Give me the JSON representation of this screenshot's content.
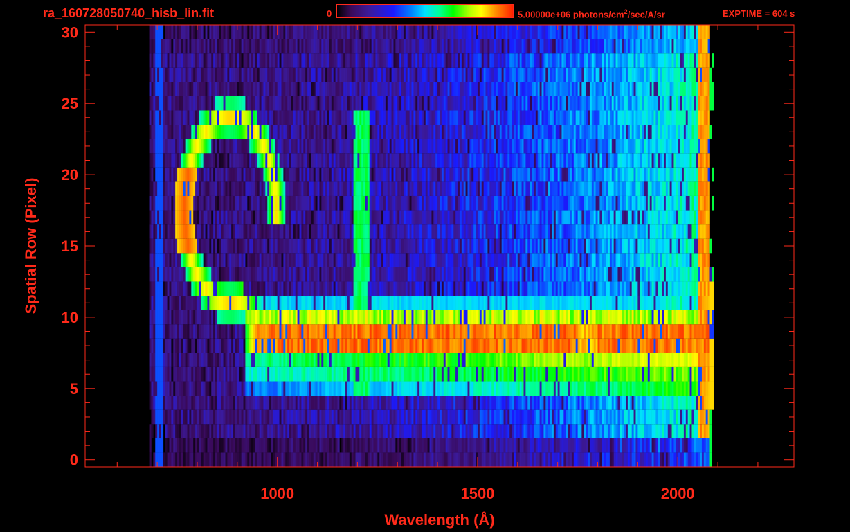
{
  "header": {
    "file_title": "ra_160728050740_hisb_lin.fit",
    "colorbar_min": "0",
    "colorbar_max_prefix": "5.00000e+06 photons/cm",
    "colorbar_max_sup": "2",
    "colorbar_max_suffix": "/sec/A/sr",
    "exptime": "EXPTIME = 604 s"
  },
  "colors": {
    "axis": "#ff2a1a",
    "background": "#000000"
  },
  "chart_data": {
    "type": "heatmap",
    "title": "ra_160728050740_hisb_lin.fit",
    "xlabel": "Wavelength (Å)",
    "ylabel": "Spatial Row (Pixel)",
    "xlim": [
      520,
      2290
    ],
    "ylim": [
      -0.5,
      30.5
    ],
    "x_tick_labels": [
      "1000",
      "1500",
      "2000"
    ],
    "x_ticks": [
      1000,
      1500,
      2000
    ],
    "y_tick_labels": [
      "0",
      "5",
      "10",
      "15",
      "20",
      "25",
      "30"
    ],
    "y_ticks": [
      0,
      5,
      10,
      15,
      20,
      25,
      30
    ],
    "colorbar": {
      "min": 0,
      "max": 5000000,
      "unit": "photons/cm^2/sec/A/sr"
    },
    "colormap": [
      "#000000",
      "#3a0a5a",
      "#3b1a9a",
      "#1a1aff",
      "#0080ff",
      "#00e0ff",
      "#00ff9a",
      "#00ff00",
      "#b0ff00",
      "#ffff00",
      "#ff9000",
      "#ff2000"
    ],
    "data_extent": {
      "x": [
        680,
        2090
      ],
      "rows": [
        0,
        30
      ]
    },
    "features": [
      {
        "name": "bright spectrum",
        "rows": [
          8,
          10
        ],
        "x": [
          920,
          2080
        ],
        "level": 0.95
      },
      {
        "name": "moderate spectrum",
        "rows": [
          5,
          7
        ],
        "x": [
          900,
          2060
        ],
        "level": 0.55
      },
      {
        "name": "upper spectrum band",
        "rows": [
          11,
          11
        ],
        "x": [
          930,
          2060
        ],
        "level": 0.45
      },
      {
        "name": "emission line 1216",
        "x": [
          1190,
          1225
        ],
        "rows": [
          5,
          24
        ],
        "level": 0.6
      },
      {
        "name": "red edge",
        "x": [
          2050,
          2075
        ],
        "rows": [
          2,
          30
        ],
        "level": 0.9
      },
      {
        "name": "ring arc",
        "center_x": 880,
        "center_row": 17.5,
        "radius_x": 115,
        "radius_rows": 6.5,
        "level": 0.65
      }
    ]
  }
}
